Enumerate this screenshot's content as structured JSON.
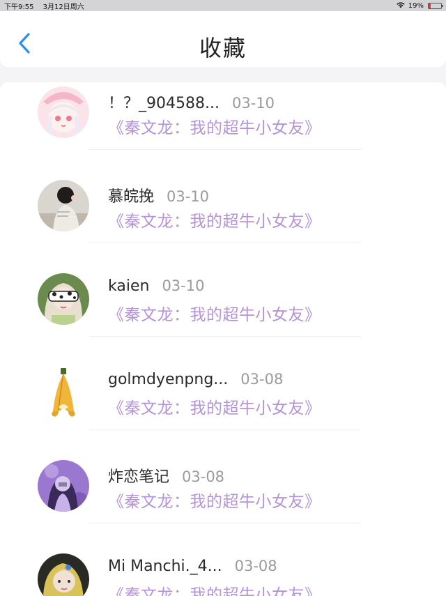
{
  "status_bar": {
    "time": "下午9:55",
    "date": "3月12日周六",
    "battery": "19%",
    "battery_level": 0.19
  },
  "header": {
    "title": "收藏",
    "back_icon": "chevron-left-icon",
    "accent_color": "#2a8ef0"
  },
  "favorites": [
    {
      "name": "！？_904588...",
      "date": "03-10",
      "book": "《秦文龙：我的超牛小女友》"
    },
    {
      "name": "慕皖挽",
      "date": "03-10",
      "book": "《秦文龙：我的超牛小女友》"
    },
    {
      "name": "kaien",
      "date": "03-10",
      "book": "《秦文龙：我的超牛小女友》"
    },
    {
      "name": "golmdyenpng...",
      "date": "03-08",
      "book": "《秦文龙：我的超牛小女友》"
    },
    {
      "name": "炸恋笔记",
      "date": "03-08",
      "book": "《秦文龙：我的超牛小女友》"
    },
    {
      "name": "Mi Manchi._4...",
      "date": "03-08",
      "book": "《秦文龙：我的超牛小女友》"
    }
  ],
  "colors": {
    "book_title": "#b593d8",
    "date": "#9a9a9a",
    "name": "#2a2a2a"
  }
}
